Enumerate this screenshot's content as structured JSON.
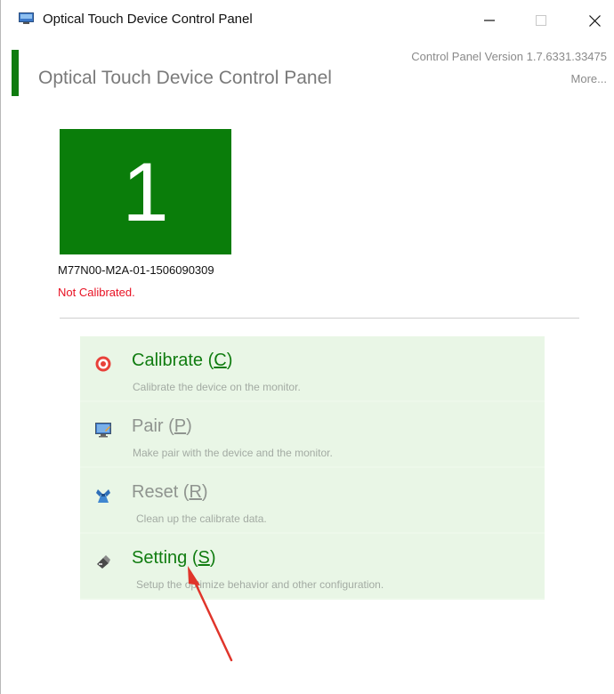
{
  "window": {
    "title": "Optical Touch Device Control Panel",
    "minimize_symbol": "—",
    "maximize_symbol": "☐",
    "close_symbol": "✕"
  },
  "header": {
    "title": "Optical Touch Device Control Panel",
    "version": "Control Panel Version 1.7.6331.33475",
    "more": "More..."
  },
  "device": {
    "number": "1",
    "id": "M77N00-M2A-01-1506090309",
    "status": "Not Calibrated."
  },
  "menu": [
    {
      "label": "Calibrate (",
      "key": "C",
      "suffix": ")",
      "description": "Calibrate the device on the monitor.",
      "icon": "target-icon",
      "enabled": true
    },
    {
      "label": "Pair (",
      "key": "P",
      "suffix": ")",
      "description": "Make pair with the device and the monitor.",
      "icon": "monitor-icon",
      "enabled": false
    },
    {
      "label": "Reset (",
      "key": "R",
      "suffix": ")",
      "description": "Clean up the calibrate data.",
      "icon": "reset-icon",
      "enabled": false
    },
    {
      "label": "Setting (",
      "key": "S",
      "suffix": ")",
      "description": "Setup the optimize behavior and other configuration.",
      "icon": "settings-icon",
      "enabled": true
    }
  ],
  "colors": {
    "accent": "#107c10",
    "tile": "#0a7d0a",
    "status_error": "#e81123",
    "menu_bg": "#e9f6e6",
    "annotation_arrow": "#e0352b"
  }
}
